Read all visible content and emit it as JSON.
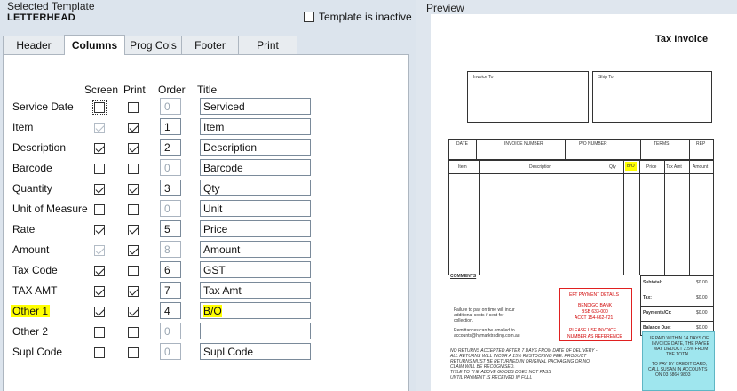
{
  "template": {
    "label": "Selected Template",
    "name": "LETTERHEAD",
    "inactive_label": "Template is inactive"
  },
  "tabs": [
    {
      "label": "Header"
    },
    {
      "label": "Columns"
    },
    {
      "label": "Prog Cols"
    },
    {
      "label": "Footer"
    },
    {
      "label": "Print"
    }
  ],
  "columns_headers": {
    "screen": "Screen",
    "print": "Print",
    "order": "Order",
    "title": "Title"
  },
  "rows": [
    {
      "label": "Service Date",
      "order": "0",
      "title": "Serviced"
    },
    {
      "label": "Item",
      "order": "1",
      "title": "Item"
    },
    {
      "label": "Description",
      "order": "2",
      "title": "Description"
    },
    {
      "label": "Barcode",
      "order": "0",
      "title": "Barcode"
    },
    {
      "label": "Quantity",
      "order": "3",
      "title": "Qty"
    },
    {
      "label": "Unit of Measure",
      "order": "0",
      "title": "Unit"
    },
    {
      "label": "Rate",
      "order": "5",
      "title": "Price"
    },
    {
      "label": "Amount",
      "order": "8",
      "title": "Amount"
    },
    {
      "label": "Tax Code",
      "order": "6",
      "title": "GST"
    },
    {
      "label": "TAX AMT",
      "order": "7",
      "title": "Tax Amt"
    },
    {
      "label": "Other 1",
      "order": "4",
      "title": "B/O"
    },
    {
      "label": "Other 2",
      "order": "0",
      "title": ""
    },
    {
      "label": "Supl Code",
      "order": "0",
      "title": "Supl Code"
    }
  ],
  "preview": {
    "label": "Preview",
    "title": "Tax Invoice",
    "invoice_to": "Invoice To",
    "ship_to": "Ship To",
    "header_cols": [
      "DATE",
      "INVOICE NUMBER",
      "P/O NUMBER",
      "TERMS",
      "REP"
    ],
    "item_cols": [
      "Item",
      "Description",
      "Qty",
      "B/O",
      "Price",
      "Tax Amt",
      "Amount"
    ],
    "comments": "COMMENTS",
    "totals": [
      {
        "label": "Subtotal:",
        "value": "$0.00"
      },
      {
        "label": "Tax:",
        "value": "$0.00"
      },
      {
        "label": "Payments/Cr:",
        "value": "$0.00"
      },
      {
        "label": "Balance Due:",
        "value": "$0.00"
      }
    ],
    "eft": {
      "heading": "EFT PAYMENT DETAILS",
      "bank": "BENDIGO BANK",
      "bsb": "BSB 633-000",
      "acct": "ACCT 154-662-721",
      "note1": "PLEASE USE INVOICE",
      "note2": "NUMBER AS REFERENCE"
    },
    "failure_text1": "Failure to pay on time will incur",
    "failure_text2": "additional costs if sent for",
    "failure_text3": "collection.",
    "remit_text1": "Remittances can be emailed to",
    "remit_text2": "accounts@hymarktrading.com.au",
    "returns_text1": "NO RETURNS ACCEPTED AFTER 7 DAYS FROM DATE OF DELIVERY -",
    "returns_text2": "ALL RETURNS WILL INCUR A 15% RESTOCKING FEE. PRODUCT",
    "returns_text3": "RETURNS MUST BE RETURNED IN ORIGINAL PACKAGING OR NO",
    "returns_text4": "CLAIM WILL BE RECOGNISED.",
    "returns_text5": "TITLE TO THE ABOVE GOODS DOES NOT PASS",
    "returns_text6": "UNTIL PAYMENT IS RECEIVED IN FULL",
    "paid_text1": "IF PAID WITHIN 14 DAYS OF",
    "paid_text2": "INVOICE DATE, THE PAYEE",
    "paid_text3": "MAY DEDUCT 2.5% FROM",
    "paid_text4": "THE TOTAL.",
    "paid_text5": "TO PAY BY CREDIT CARD,",
    "paid_text6": "CALL SUSAN IN ACCOUNTS",
    "paid_text7": "ON 03 5864 9803"
  }
}
